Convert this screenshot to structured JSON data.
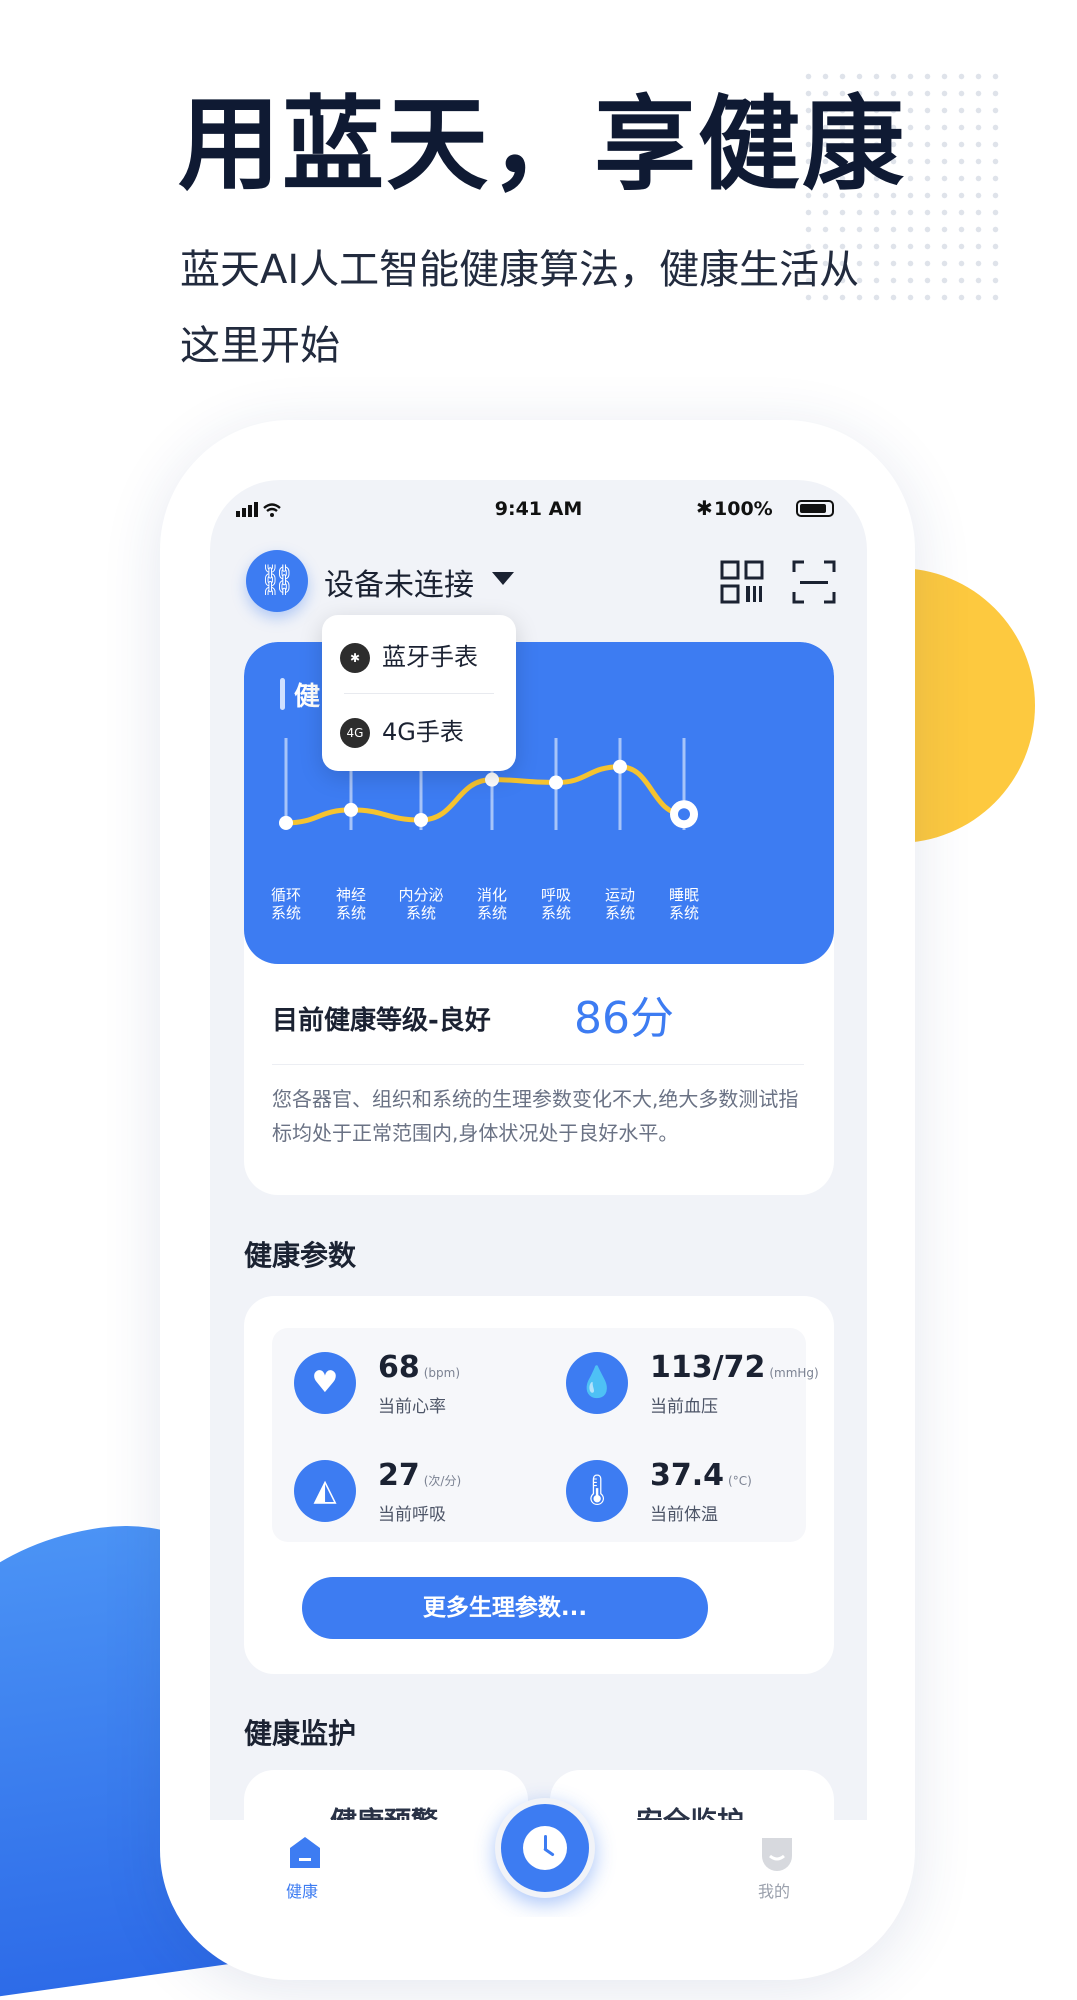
{
  "promo": {
    "headline": "用蓝天，享健康",
    "subline": "蓝天AI人工智能健康算法，健康生活从这里开始"
  },
  "status_bar": {
    "time": "9:41 AM",
    "battery": "100%"
  },
  "device": {
    "label": "设备未连接",
    "menu": [
      {
        "badge": "✱",
        "label": "蓝牙手表"
      },
      {
        "badge": "4G",
        "label": "4G手表"
      }
    ]
  },
  "health_card": {
    "title": "健",
    "level_label": "目前健康等级-良好",
    "score": "86分",
    "description": "您各器官、组织和系统的生理参数变化不大,绝大多数测试指标均处于正常范围内,身体状况处于良好水平。"
  },
  "chart_data": {
    "type": "line",
    "categories": [
      [
        "循环",
        "系统"
      ],
      [
        "神经",
        "系统"
      ],
      [
        "内分泌",
        "系统"
      ],
      [
        "消化",
        "系统"
      ],
      [
        "呼吸",
        "系统"
      ],
      [
        "运动",
        "系统"
      ],
      [
        "睡眠",
        "系统"
      ]
    ],
    "values": [
      0.48,
      0.57,
      0.5,
      0.78,
      0.76,
      0.87,
      0.54
    ],
    "ylim": [
      0,
      1
    ],
    "line_color": "#f5c330",
    "background": "#3d7cf2"
  },
  "params": {
    "title": "健康参数",
    "items": [
      {
        "icon": "heart-rate-icon",
        "value": "68",
        "unit": "(bpm)",
        "label": "当前心率"
      },
      {
        "icon": "blood-drop-icon",
        "value": "113/72",
        "unit": "(mmHg)",
        "label": "当前血压"
      },
      {
        "icon": "nose-icon",
        "value": "27",
        "unit": "(次/分)",
        "label": "当前呼吸"
      },
      {
        "icon": "thermometer-icon",
        "value": "37.4",
        "unit": "(°C)",
        "label": "当前体温"
      }
    ],
    "more_button": "更多生理参数..."
  },
  "monitor": {
    "title": "健康监护",
    "card1": "健康预警",
    "card2": "安全监护"
  },
  "tabbar": {
    "home": "健康",
    "mine": "我的"
  },
  "colors": {
    "accent": "#3d7cf2",
    "yellow": "#fdc93f"
  }
}
